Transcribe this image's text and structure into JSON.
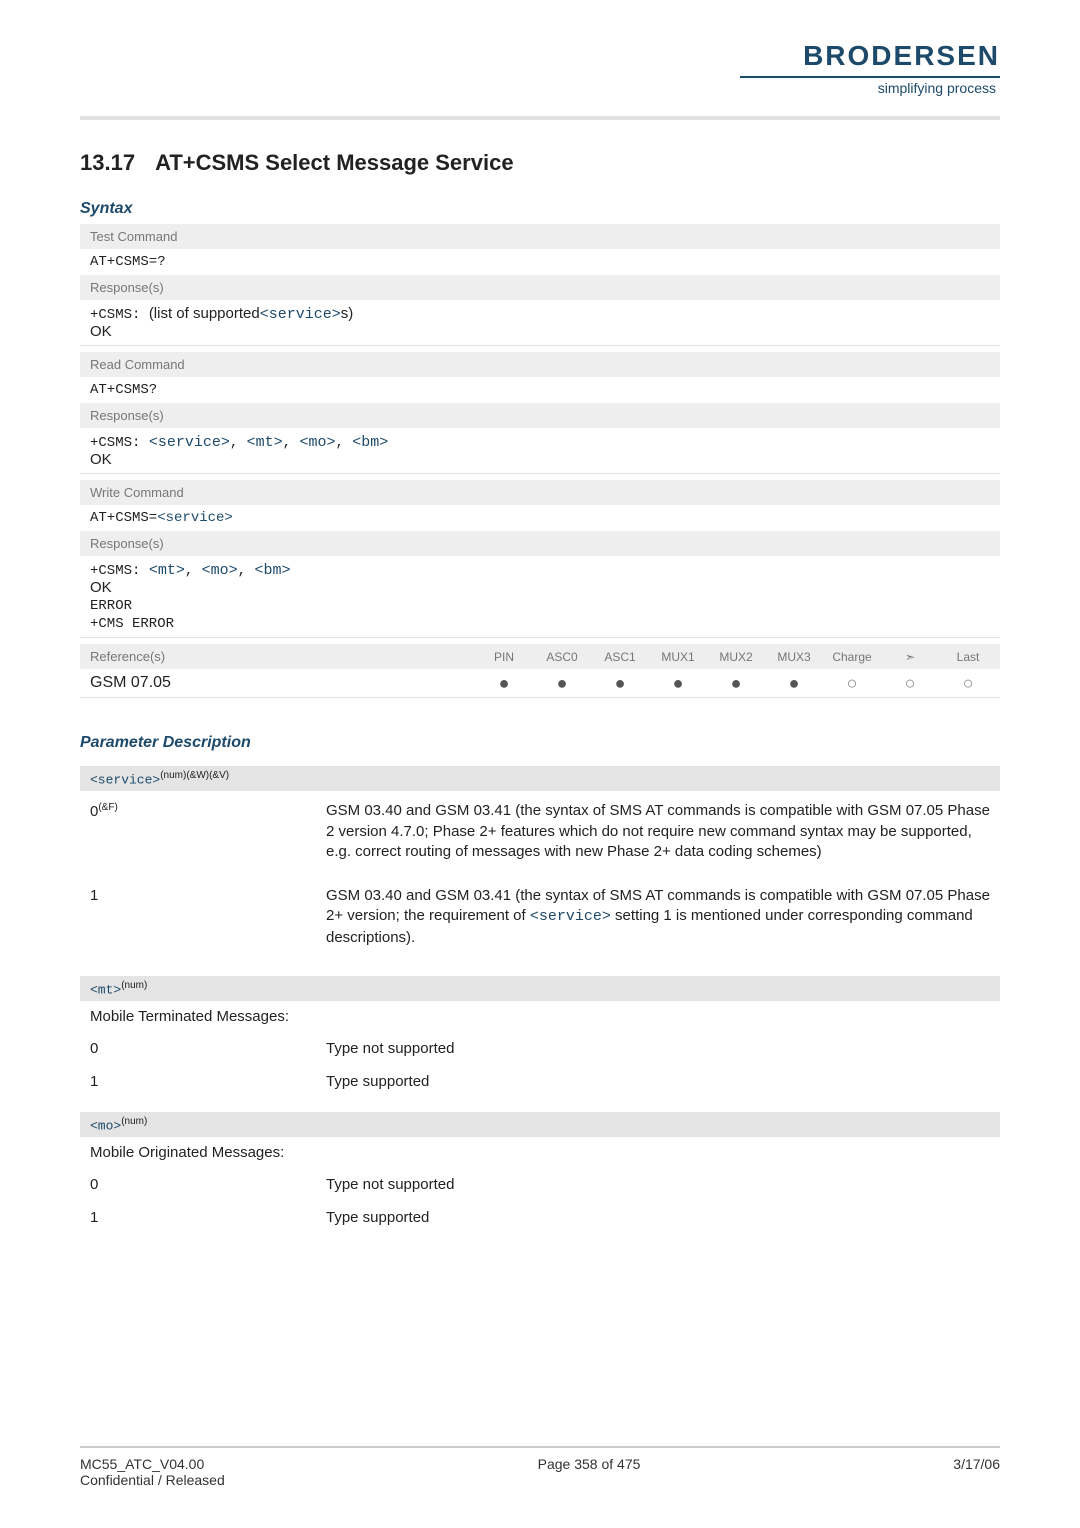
{
  "brand": {
    "name": "BRODERSEN",
    "tagline": "simplifying process"
  },
  "section": {
    "number": "13.17",
    "title": "AT+CSMS   Select Message Service"
  },
  "syntax": {
    "heading": "Syntax",
    "test": {
      "label": "Test Command",
      "cmd": "AT+CSMS=?",
      "respLabel": "Response(s)",
      "line_pre": "+CSMS: ",
      "line_mid": "(list of supported",
      "line_param": "<service>",
      "line_suf": "s)",
      "ok": "OK"
    },
    "read": {
      "label": "Read Command",
      "cmd": "AT+CSMS?",
      "respLabel": "Response(s)",
      "pre": "+CSMS: ",
      "p1": "<service>",
      "p2": "<mt>",
      "p3": "<mo>",
      "p4": "<bm>",
      "ok": "OK"
    },
    "write": {
      "label": "Write Command",
      "cmd_pre": "AT+CSMS=",
      "cmd_param": "<service>",
      "respLabel": "Response(s)",
      "pre": "+CSMS: ",
      "p1": "<mt>",
      "p2": "<mo>",
      "p3": "<bm>",
      "ok": "OK",
      "err1": "ERROR",
      "err2": "+CMS ERROR"
    },
    "ref": {
      "label": "Reference(s)",
      "value": "GSM 07.05",
      "cols": {
        "c1": "PIN",
        "c2": "ASC0",
        "c3": "ASC1",
        "c4": "MUX1",
        "c5": "MUX2",
        "c6": "MUX3",
        "c7": "Charge",
        "c8": "➣",
        "c9": "Last"
      },
      "dots": {
        "d1": "●",
        "d2": "●",
        "d3": "●",
        "d4": "●",
        "d5": "●",
        "d6": "●",
        "d7": "○",
        "d8": "○",
        "d9": "○"
      }
    }
  },
  "params": {
    "heading": "Parameter Description",
    "service": {
      "name": "<service>",
      "sup": "(num)(&W)(&V)",
      "row0key": "0",
      "row0sup": "(&F)",
      "row0val": "GSM 03.40 and GSM 03.41 (the syntax of SMS AT commands is compatible with GSM 07.05 Phase 2 version 4.7.0; Phase 2+ features which do not require new command syntax may be supported, e.g. correct routing of messages with new Phase 2+ data coding schemes)",
      "row1key": "1",
      "row1val_a": "GSM 03.40 and GSM 03.41 (the syntax of SMS AT commands is compatible with GSM 07.05 Phase 2+ version; the requirement of ",
      "row1val_param": "<service>",
      "row1val_b": " setting 1 is mentioned under corresponding command descriptions)."
    },
    "mt": {
      "name": "<mt>",
      "sup": "(num)",
      "title": "Mobile Terminated Messages:",
      "k0": "0",
      "v0": "Type not supported",
      "k1": "1",
      "v1": "Type supported"
    },
    "mo": {
      "name": "<mo>",
      "sup": "(num)",
      "title": "Mobile Originated Messages:",
      "k0": "0",
      "v0": "Type not supported",
      "k1": "1",
      "v1": "Type supported"
    }
  },
  "footer": {
    "left1": "MC55_ATC_V04.00",
    "left2": "Confidential / Released",
    "center": "Page 358 of 475",
    "right": "3/17/06"
  }
}
